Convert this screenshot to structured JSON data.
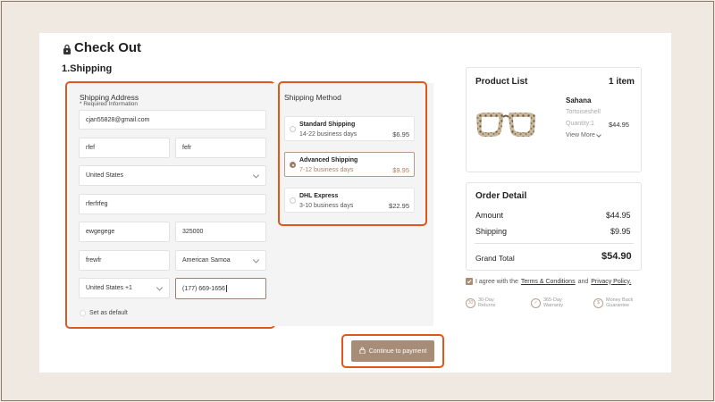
{
  "page": {
    "title": "Check Out",
    "section": "1.Shipping"
  },
  "address": {
    "heading": "Shipping Address",
    "required_note": "* Required Information",
    "email": "cjan55828@gmail.com",
    "first_name": "rfef",
    "last_name": "fefr",
    "country": "United States",
    "address_line": "rferfrfeg",
    "city": "ewgegege",
    "zip": "325000",
    "address2": "frewfr",
    "state": "American Samoa",
    "phone_country": "United States +1",
    "phone": "(177) 669-1656",
    "default_label": "Set as default"
  },
  "shipping": {
    "heading": "Shipping Method",
    "options": [
      {
        "name": "Standard Shipping",
        "days": "14-22 business days",
        "price": "$6.95",
        "selected": false
      },
      {
        "name": "Advanced Shipping",
        "days": "7-12 business days",
        "price": "$9.95",
        "selected": true
      },
      {
        "name": "DHL Express",
        "days": "3-10 business days",
        "price": "$22.95",
        "selected": false
      }
    ]
  },
  "product_list": {
    "heading": "Product List",
    "count": "1 item",
    "product": {
      "name": "Sahana",
      "color": "Tortoiseshell",
      "quantity": "Quantity:1",
      "price": "$44.95",
      "view_more": "View More"
    }
  },
  "order": {
    "heading": "Order Detail",
    "amount_label": "Amount",
    "amount": "$44.95",
    "shipping_label": "Shipping",
    "shipping": "$9.95",
    "total_label": "Grand Total",
    "total": "$54.90",
    "agree_prefix": "I agree with the",
    "terms": "Terms & Conditions",
    "and": "and",
    "privacy": "Privacy Policy."
  },
  "badges": [
    {
      "line1": "30-Day",
      "line2": "Returns"
    },
    {
      "line1": "365-Day",
      "line2": "Warranty"
    },
    {
      "line1": "Money Back",
      "line2": "Guarantee"
    }
  ],
  "continue_label": "Continue to payment",
  "colors": {
    "accent": "#a78c77",
    "highlight": "#e0561d",
    "panel": "#f4f4f4"
  },
  "icons": [
    "lock-icon",
    "chevron-down-icon",
    "shield-icon",
    "return-icon",
    "money-icon",
    "checkbox-icon"
  ]
}
